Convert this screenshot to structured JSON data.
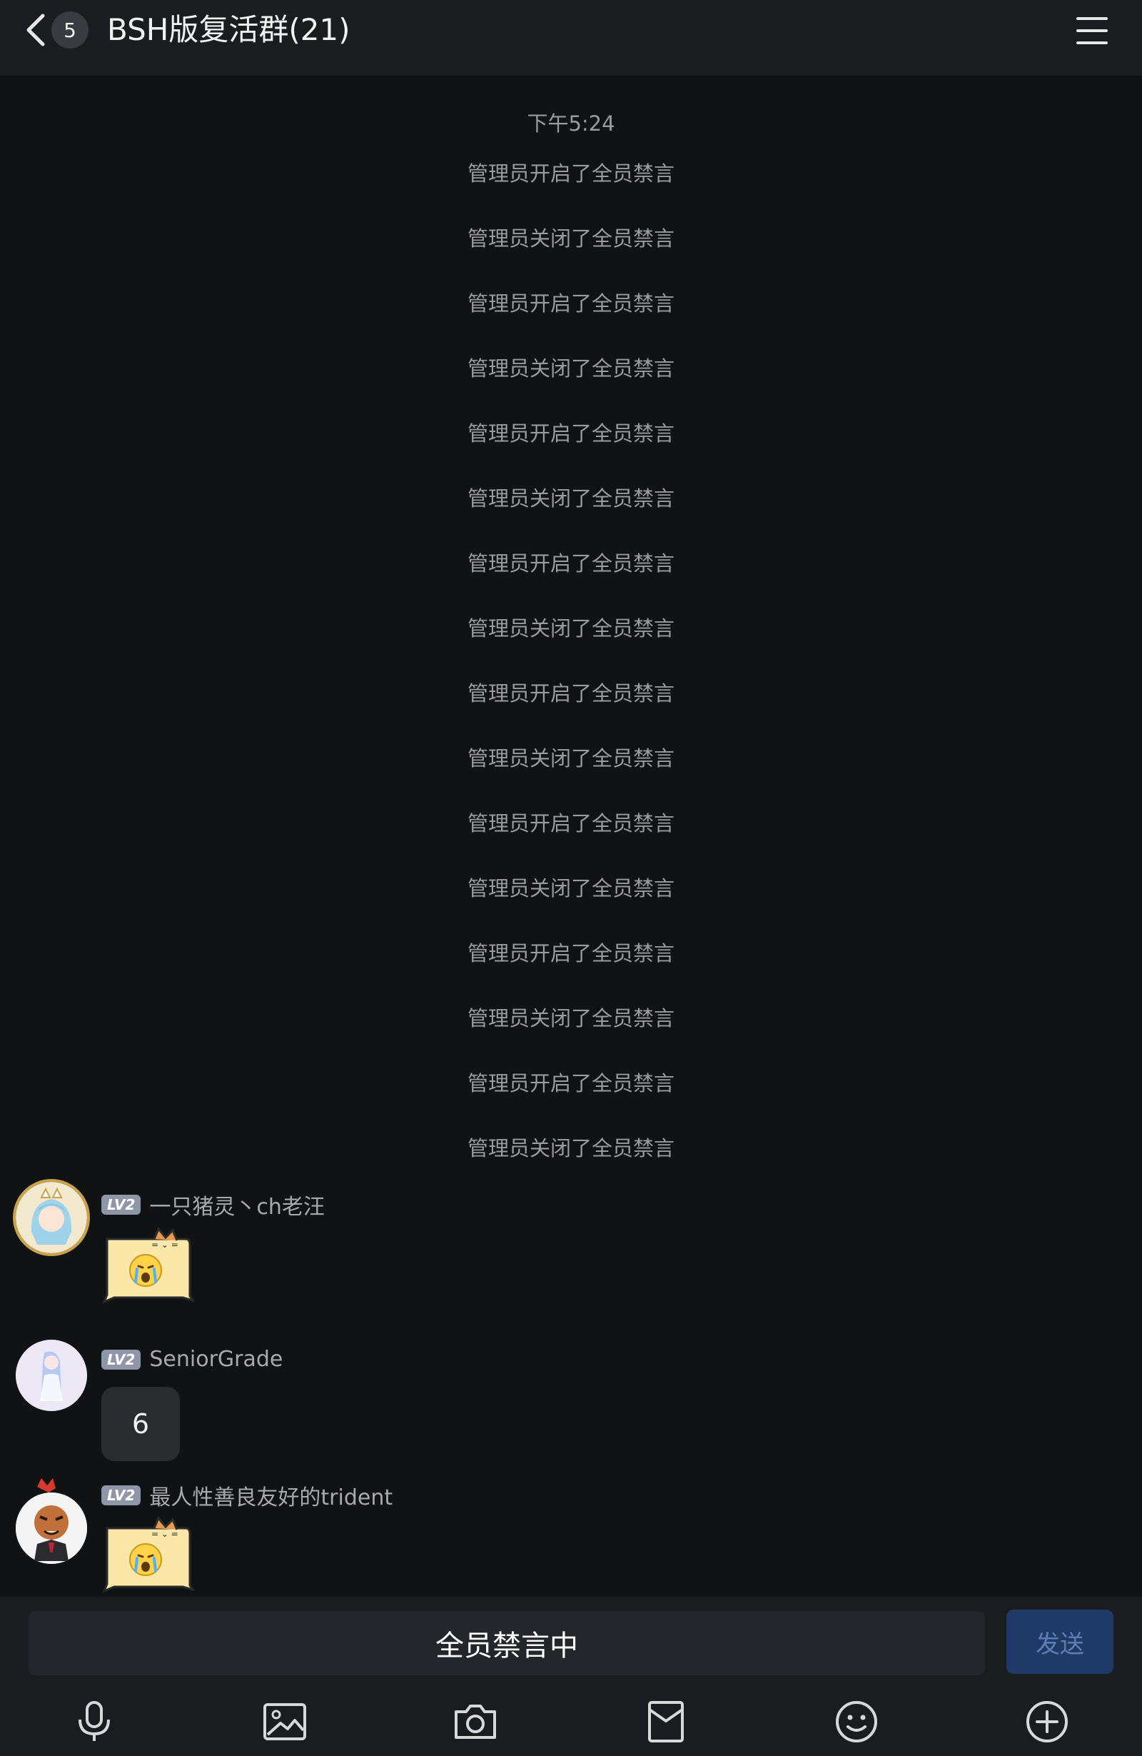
{
  "header": {
    "unread_count": "5",
    "title": "BSH版复活群(21)"
  },
  "chat": {
    "timestamp": "下午5:24",
    "system_messages": [
      "管理员开启了全员禁言",
      "管理员关闭了全员禁言",
      "管理员开启了全员禁言",
      "管理员关闭了全员禁言",
      "管理员开启了全员禁言",
      "管理员关闭了全员禁言",
      "管理员开启了全员禁言",
      "管理员关闭了全员禁言",
      "管理员开启了全员禁言",
      "管理员关闭了全员禁言",
      "管理员开启了全员禁言",
      "管理员关闭了全员禁言",
      "管理员开启了全员禁言",
      "管理员关闭了全员禁言",
      "管理员开启了全员禁言",
      "管理员关闭了全员禁言"
    ],
    "messages": [
      {
        "level": "LV2",
        "sender": "一只猪灵丶ch老汪",
        "content_type": "sticker",
        "sticker": "crying-cat-sticker"
      },
      {
        "level": "LV2",
        "sender": "SeniorGrade",
        "content_type": "text",
        "text": "6"
      },
      {
        "level": "LV2",
        "sender": "最人性善良友好的trident",
        "content_type": "sticker",
        "sticker": "crying-cat-sticker"
      }
    ]
  },
  "input": {
    "muted_text": "全员禁言中",
    "send_label": "发送"
  },
  "toolbar": {
    "icons": [
      "microphone-icon",
      "image-icon",
      "camera-icon",
      "red-packet-icon",
      "emoji-icon",
      "plus-icon"
    ]
  },
  "colors": {
    "background": "#111214",
    "header": "#1b1c20",
    "system_text": "#9a9b9f",
    "send_button": "#1f3a66",
    "level_badge": "#8f96a8"
  }
}
